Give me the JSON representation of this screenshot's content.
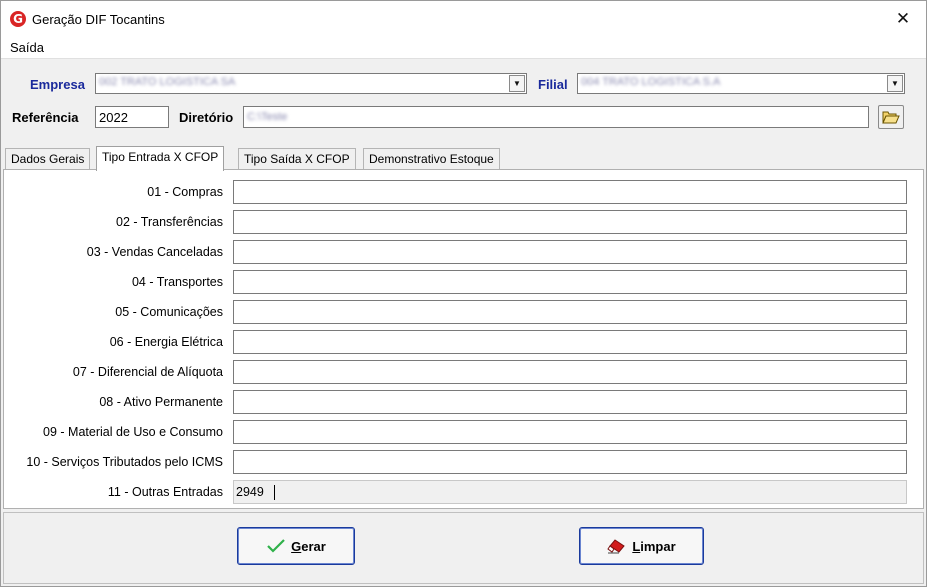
{
  "window": {
    "title": "Geração DIF Tocantins",
    "app_icon_letter": "G",
    "close_glyph": "✕"
  },
  "menu": {
    "items": [
      "Saída"
    ]
  },
  "header": {
    "empresa_label": "Empresa",
    "empresa_value": "002 TRATO LOGISTICA SA",
    "filial_label": "Filial",
    "filial_value": "004 TRATO LOGISTICA S.A",
    "referencia_label": "Referência",
    "referencia_value": "2022",
    "diretorio_label": "Diretório",
    "diretorio_value": "C:\\Teste"
  },
  "tabs": [
    {
      "label": "Dados Gerais"
    },
    {
      "label": "Tipo Entrada X CFOP"
    },
    {
      "label": "Tipo Saída X CFOP"
    },
    {
      "label": "Demonstrativo Estoque"
    }
  ],
  "rows": [
    {
      "label": "01 - Compras",
      "value": ""
    },
    {
      "label": "02 - Transferências",
      "value": ""
    },
    {
      "label": "03 - Vendas Canceladas",
      "value": ""
    },
    {
      "label": "04 - Transportes",
      "value": ""
    },
    {
      "label": "05 - Comunicações",
      "value": ""
    },
    {
      "label": "06 - Energia Elétrica",
      "value": ""
    },
    {
      "label": "07 - Diferencial de Alíquota",
      "value": ""
    },
    {
      "label": "08 - Ativo Permanente",
      "value": ""
    },
    {
      "label": "09 - Material de Uso e Consumo",
      "value": ""
    },
    {
      "label": "10 - Serviços Tributados pelo ICMS",
      "value": ""
    },
    {
      "label": "11 - Outras Entradas",
      "value": "2949"
    }
  ],
  "buttons": {
    "gerar_first": "G",
    "gerar_rest": "erar",
    "limpar_first": "L",
    "limpar_rest": "impar"
  },
  "colors": {
    "label_blue": "#1a2a9c",
    "check_green": "#2fb14a",
    "eraser_red": "#d21c1c",
    "brand_red": "#d92525"
  }
}
